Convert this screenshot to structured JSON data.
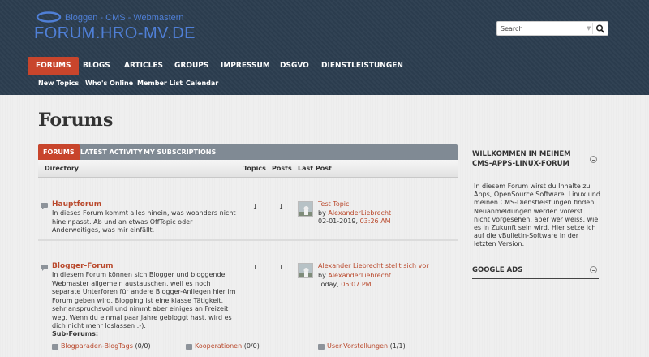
{
  "logo": {
    "tagline": "Bloggen - CMS - Webmastern",
    "name": "FORUM.HRO-MV.DE"
  },
  "search": {
    "placeholder": "Search"
  },
  "nav": {
    "tabs": [
      "FORUMS",
      "BLOGS",
      "ARTICLES",
      "GROUPS",
      "IMPRESSUM",
      "DSGVO",
      "DIENSTLEISTUNGEN"
    ],
    "active": "FORUMS",
    "sub": [
      "New Topics",
      "Who's Online",
      "Member List",
      "Calendar"
    ]
  },
  "page": {
    "title": "Forums"
  },
  "forum_tabs": {
    "items": [
      "FORUMS",
      "LATEST ACTIVITY",
      "MY SUBSCRIPTIONS"
    ],
    "active": "FORUMS"
  },
  "table": {
    "headers": {
      "directory": "Directory",
      "topics": "Topics",
      "posts": "Posts",
      "last_post": "Last Post"
    },
    "forums": [
      {
        "title": "Hauptforum",
        "description": "In dieses Forum kommt alles hinein, was woanders nicht hineinpasst. Ab und an etwas OffTopic oder Anderweitiges, was mir einfällt.",
        "topics": "1",
        "posts": "1",
        "last_post": {
          "title": "Test Topic",
          "by_prefix": "by",
          "user": "AlexanderLiebrecht",
          "date": "02-01-2019,",
          "time": "03:26 AM"
        }
      },
      {
        "title": "Blogger-Forum",
        "description": "In diesem Forum können sich Blogger und bloggende Webmaster allgemein austauschen, weil es noch separate Unterforen für andere Blogger-Anliegen hier im Forum geben wird. Blogging ist eine klasse Tätigkeit, sehr anspruchsvoll und nimmt aber einiges an Freizeit weg. Wenn du einmal paar Jahre gebloggt hast, wird es dich nicht mehr loslassen :-).",
        "topics": "1",
        "posts": "1",
        "last_post": {
          "title": "Alexander Liebrecht stellt sich vor",
          "by_prefix": "by",
          "user": "AlexanderLiebrecht",
          "date": "Today,",
          "time": "05:07 PM"
        },
        "sub_forums_label": "Sub-Forums:",
        "sub_forums": [
          {
            "name": "Blogparaden-BlogTags",
            "count": "(0/0)"
          },
          {
            "name": "Kooperationen",
            "count": "(0/0)"
          },
          {
            "name": "User-Vorstellungen",
            "count": "(1/1)"
          }
        ]
      }
    ]
  },
  "sidebar": {
    "welcome_title": "WILLKOMMEN IN MEINEM CMS-APPS-LINUX-FORUM",
    "welcome_text": "In diesem Forum wirst du Inhalte zu Apps, OpenSource Software, Linux und meinen CMS-Dienstleistungen finden. Neuanmeldungen werden vorerst nicht vorgesehen, aber wer weiss, wie es in Zukunft sein wird. Hier setze ich auf die vBulletin-Software in der letzten Version.",
    "ads_title": "GOOGLE ADS"
  },
  "colors": {
    "accent": "#c8452c",
    "header_bg": "#2c3e50",
    "logo": "#4f7fd6",
    "link": "#b9482b"
  }
}
